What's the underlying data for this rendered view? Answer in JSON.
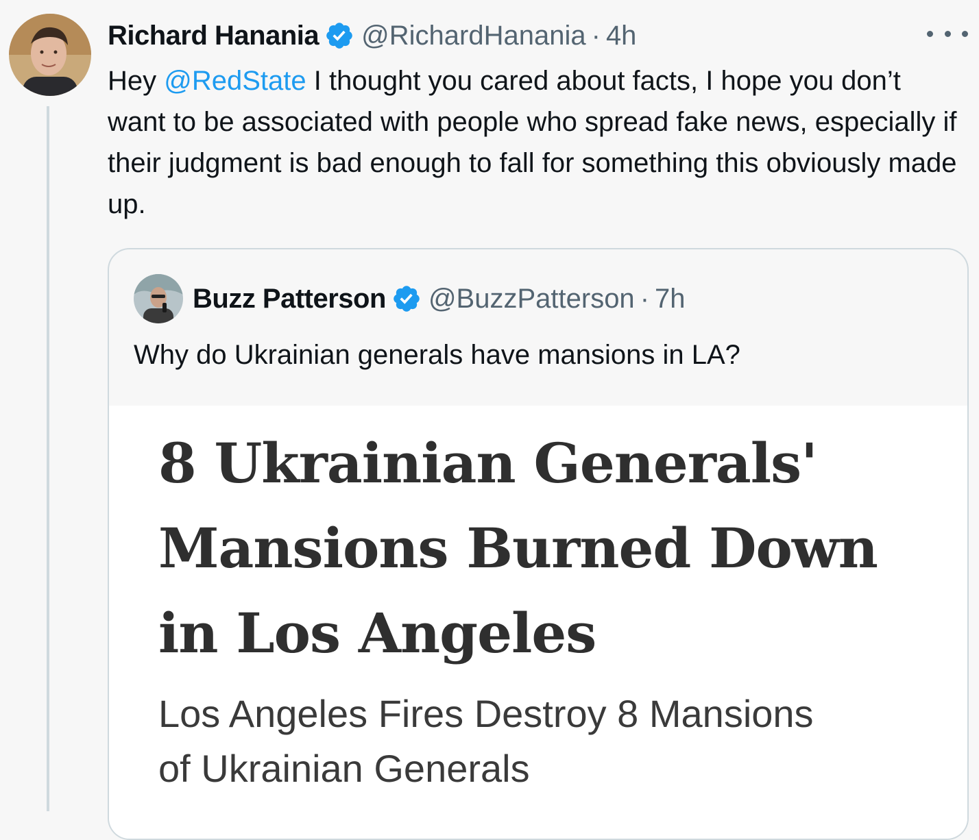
{
  "tweet": {
    "author_name": "Richard Hanania",
    "author_handle": "@RichardHanania",
    "separator": "·",
    "time": "4h",
    "text_mention": "@RedState",
    "text_rest": " I thought you cared about facts, I hope you don’t want to be associated with people who spread fake news, especially if their judgment is bad enough to fall for something this obviously made up.",
    "text_prefix": "Hey ",
    "verified_icon": "verified-badge-icon",
    "more_icon": "more-options-icon"
  },
  "quote": {
    "author_name": "Buzz Patterson",
    "author_handle": "@BuzzPatterson",
    "separator": "·",
    "time": "7h",
    "text": "Why do Ukrainian generals have mansions in LA?",
    "image": {
      "headline": "8 Ukrainian Generals' Mansions Burned Down in Los Angeles",
      "subheadline": "Los Angeles Fires Destroy 8 Mansions of Ukrainian Generals"
    }
  },
  "colors": {
    "accent": "#1d9bf0",
    "background": "#f7f7f7",
    "secondary_text": "#536471",
    "border": "#cfd9de"
  }
}
